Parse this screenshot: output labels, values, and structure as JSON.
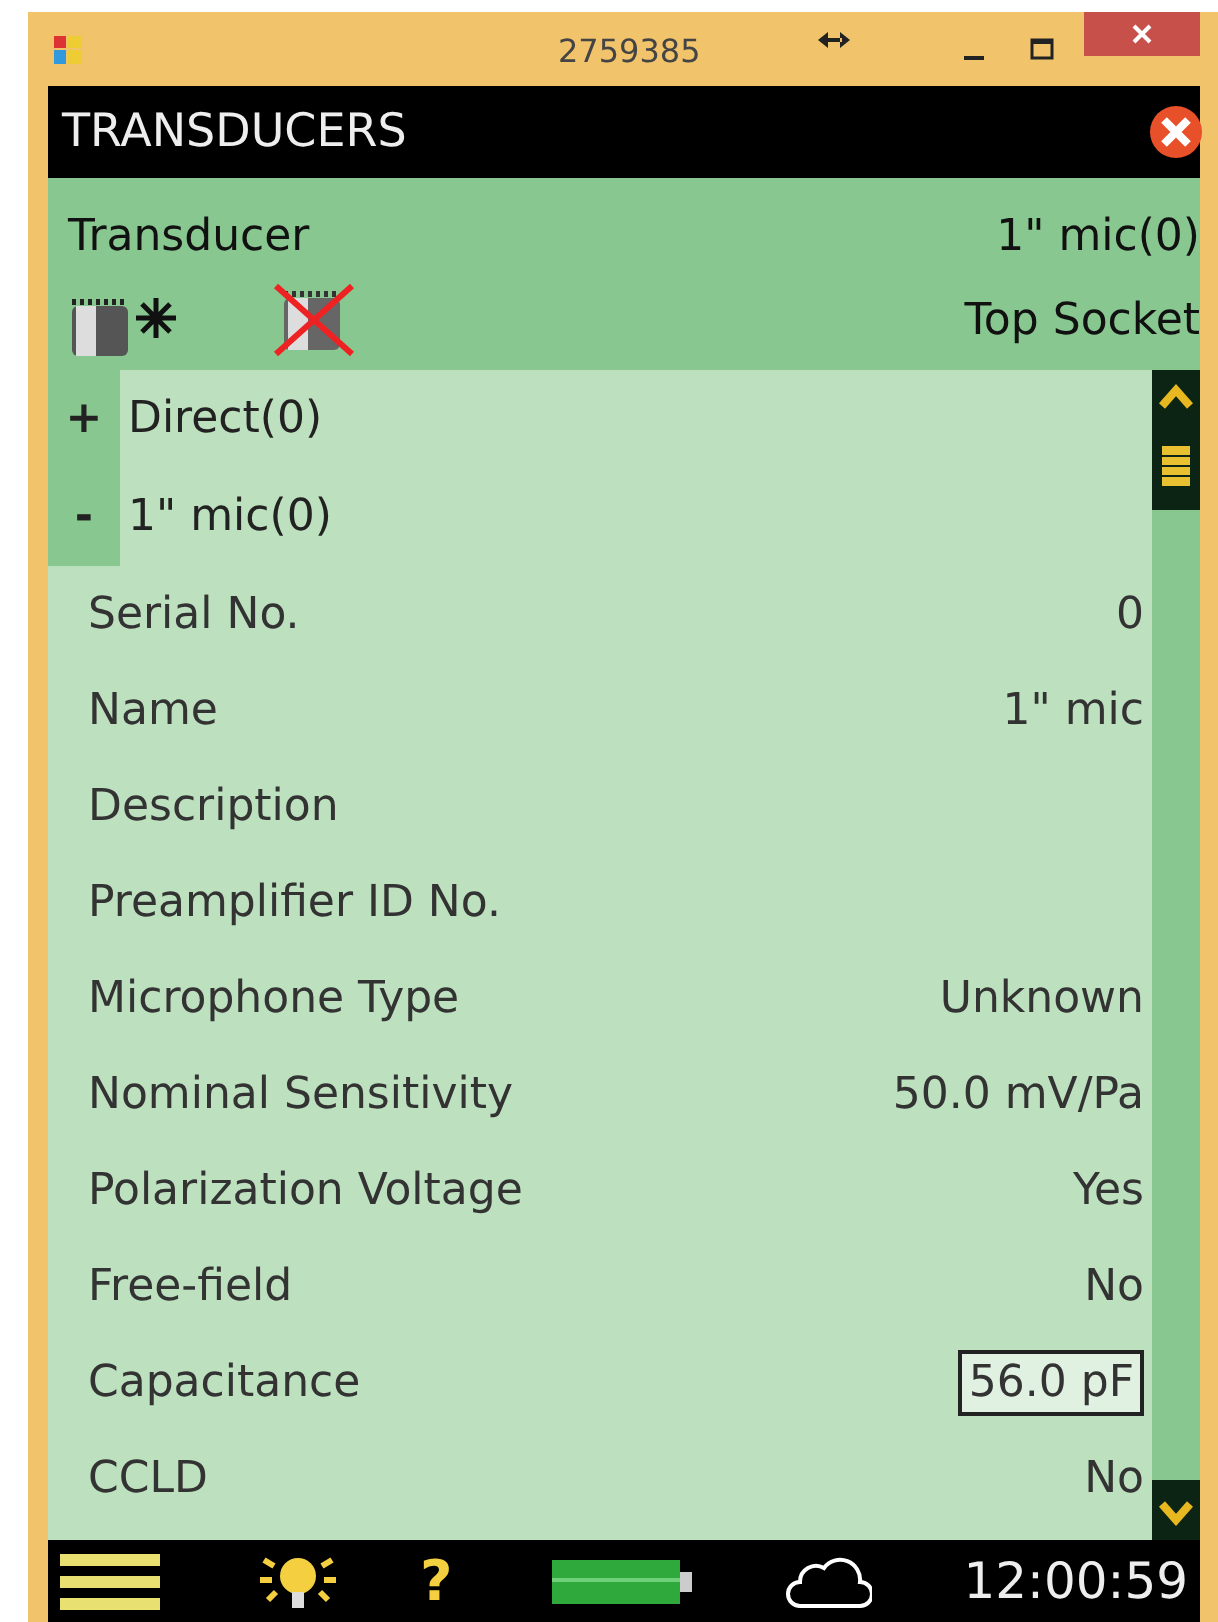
{
  "window": {
    "title": "2759385"
  },
  "header": {
    "title": "TRANSDUCERS"
  },
  "transducer": {
    "label": "Transducer",
    "value": "1\" mic(0)",
    "socket": "Top Socket"
  },
  "tree": [
    {
      "sign": "+",
      "label": "Direct(0)"
    },
    {
      "sign": "-",
      "label": "1\" mic(0)"
    }
  ],
  "properties": [
    {
      "kind": "text",
      "label": "Serial No.",
      "value": "0"
    },
    {
      "kind": "text",
      "label": "Name",
      "value": "1\" mic"
    },
    {
      "label": "Description"
    },
    {
      "label": "Preamplifier ID No."
    },
    {
      "kind": "text",
      "label": "Microphone Type",
      "value": "Unknown"
    },
    {
      "kind": "text",
      "label": "Nominal Sensitivity",
      "value": "50.0 mV/Pa"
    },
    {
      "kind": "text",
      "label": "Polarization Voltage",
      "value": "Yes"
    },
    {
      "kind": "text",
      "label": "Free-field",
      "value": "No"
    },
    {
      "kind": "field",
      "label": "Capacitance",
      "value": "56.0 pF"
    },
    {
      "kind": "text",
      "label": "CCLD",
      "value": "No"
    }
  ],
  "status_bar": {
    "help": "?",
    "time": "12:00:59"
  }
}
